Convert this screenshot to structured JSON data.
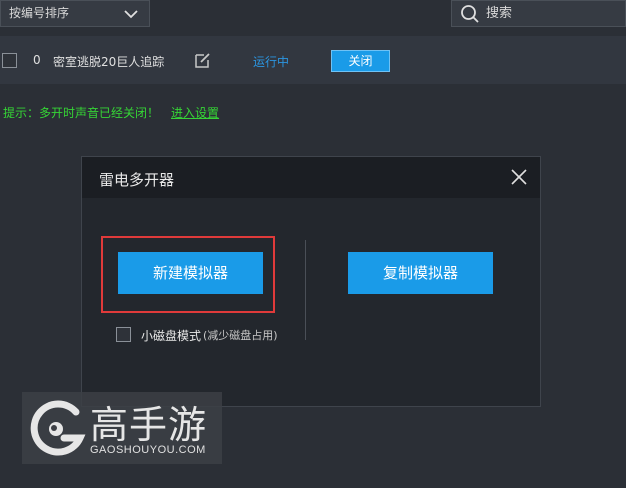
{
  "toolbar": {
    "sort_label": "按编号排序",
    "search_placeholder": "搜索"
  },
  "instances": [
    {
      "index": "0",
      "name": "密室逃脱20巨人追踪",
      "status": "运行中",
      "action": "关闭"
    }
  ],
  "hint": {
    "text": "提示：多开时声音已经关闭！",
    "link": "进入设置"
  },
  "dialog": {
    "title": "雷电多开器",
    "new_button": "新建模拟器",
    "copy_button": "复制模拟器",
    "small_disk_label": "小磁盘模式",
    "small_disk_note": "(减少磁盘占用)"
  },
  "watermark": {
    "brand": "高手游",
    "domain": "GAOSHOUYOU.COM"
  },
  "colors": {
    "accent": "#1a9be8",
    "highlight": "#e03a3a",
    "hint": "#35d535"
  }
}
